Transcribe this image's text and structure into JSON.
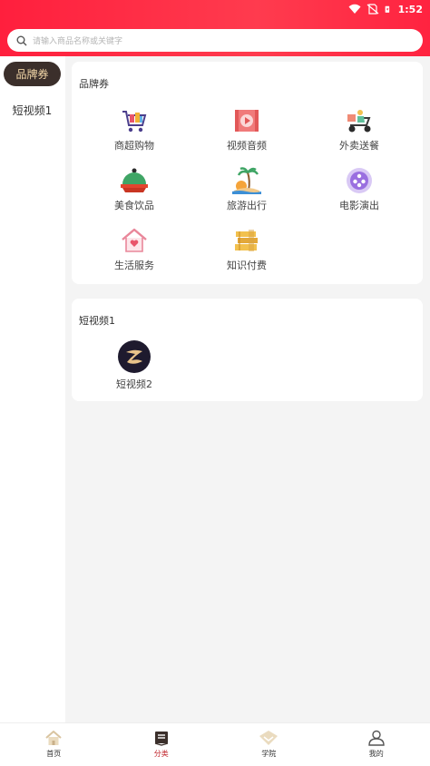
{
  "status": {
    "time": "1:52"
  },
  "search": {
    "placeholder": "请输入商品名称或关键字"
  },
  "sidebar": {
    "items": [
      {
        "label": "品牌券",
        "active": true
      },
      {
        "label": "短视频1",
        "active": false
      }
    ]
  },
  "sections": [
    {
      "title": "品牌券",
      "items": [
        {
          "label": "商超购物",
          "icon": "shopping-cart-icon"
        },
        {
          "label": "视频音频",
          "icon": "film-play-icon"
        },
        {
          "label": "外卖送餐",
          "icon": "delivery-scooter-icon"
        },
        {
          "label": "美食饮品",
          "icon": "food-cloche-icon"
        },
        {
          "label": "旅游出行",
          "icon": "palm-island-icon"
        },
        {
          "label": "电影演出",
          "icon": "film-reel-icon"
        },
        {
          "label": "生活服务",
          "icon": "house-heart-icon"
        },
        {
          "label": "知识付费",
          "icon": "books-icon"
        }
      ]
    },
    {
      "title": "短视频1",
      "items": [
        {
          "label": "短视频2",
          "icon": "brand-logo-icon"
        }
      ]
    }
  ],
  "tabbar": [
    {
      "label": "首页",
      "icon": "home-icon",
      "active": false
    },
    {
      "label": "分类",
      "icon": "category-icon",
      "active": true
    },
    {
      "label": "学院",
      "icon": "academy-icon",
      "active": false
    },
    {
      "label": "我的",
      "icon": "profile-icon",
      "active": false
    }
  ],
  "colors": {
    "accent": "#ff1f3d",
    "sidebar_active_bg": "#3b2f2b",
    "sidebar_active_text": "#f3d7a8",
    "tab_active": "#c0232a"
  }
}
